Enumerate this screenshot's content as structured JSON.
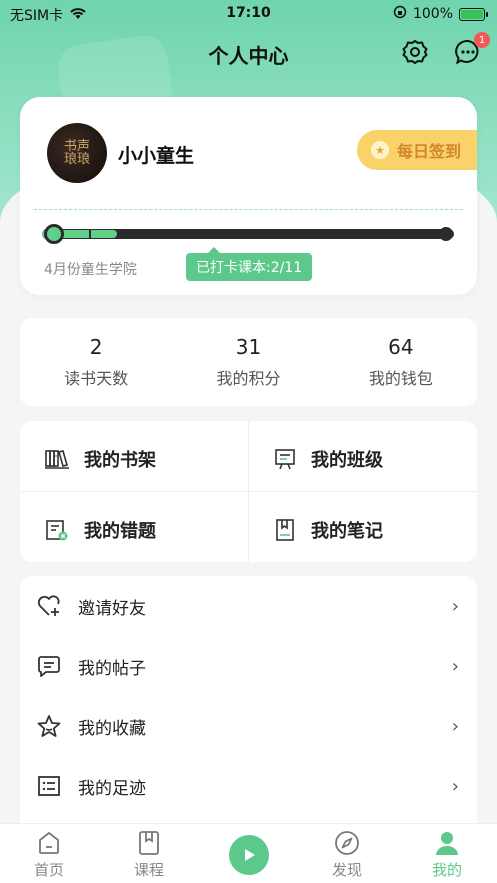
{
  "status_bar": {
    "carrier": "无SIM卡",
    "time": "17:10",
    "battery": "100%"
  },
  "header": {
    "title": "个人中心",
    "message_badge": "1"
  },
  "profile": {
    "avatar_text": "书声琅琅",
    "username": "小小童生",
    "checkin_label": "每日签到",
    "academy": "4月份童生学院",
    "checkin_progress": "已打卡课本:2/11",
    "progress_done": 2,
    "progress_total": 11
  },
  "stats": [
    {
      "value": "2",
      "label": "读书天数"
    },
    {
      "value": "31",
      "label": "我的积分"
    },
    {
      "value": "64",
      "label": "我的钱包"
    }
  ],
  "grid_menu": [
    {
      "label": "我的书架",
      "icon": "bookshelf-icon"
    },
    {
      "label": "我的班级",
      "icon": "class-board-icon"
    },
    {
      "label": "我的错题",
      "icon": "wrong-questions-icon"
    },
    {
      "label": "我的笔记",
      "icon": "notebook-icon"
    }
  ],
  "list_menu": [
    {
      "label": "邀请好友",
      "icon": "heart-plus-icon"
    },
    {
      "label": "我的帖子",
      "icon": "chat-lines-icon"
    },
    {
      "label": "我的收藏",
      "icon": "star-icon"
    },
    {
      "label": "我的足迹",
      "icon": "list-icon"
    }
  ],
  "tabbar": [
    {
      "label": "首页",
      "icon": "home-icon"
    },
    {
      "label": "课程",
      "icon": "bookmark-icon"
    },
    {
      "label": "发现",
      "icon": "compass-icon"
    },
    {
      "label": "我的",
      "icon": "person-icon",
      "active": true
    }
  ],
  "colors": {
    "accent": "#5cc88a",
    "checkin": "#f9d36a",
    "badge": "#f35858"
  }
}
